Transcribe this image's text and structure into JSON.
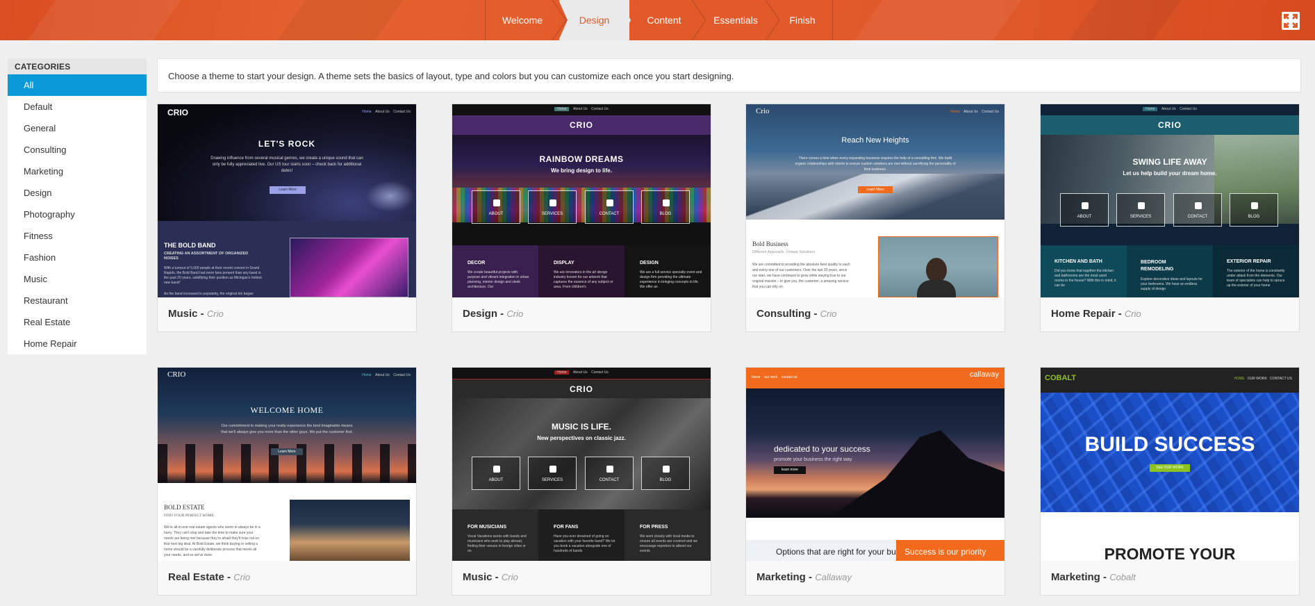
{
  "wizard": {
    "steps": [
      {
        "label": "Welcome",
        "active": false
      },
      {
        "label": "Design",
        "active": true
      },
      {
        "label": "Content",
        "active": false
      },
      {
        "label": "Essentials",
        "active": false
      },
      {
        "label": "Finish",
        "active": false
      }
    ],
    "fullscreen_icon": "fullscreen-exit-icon"
  },
  "sidebar": {
    "header": "CATEGORIES",
    "items": [
      "All",
      "Default",
      "General",
      "Consulting",
      "Marketing",
      "Design",
      "Photography",
      "Fitness",
      "Fashion",
      "Music",
      "Restaurant",
      "Real Estate",
      "Home Repair"
    ],
    "selected": "All"
  },
  "intro_text": "Choose a theme to start your design. A theme sets the basics of layout, type and colors but you can customize each once you start designing.",
  "themes": [
    {
      "name": "Music",
      "theme": "Crio",
      "preview": {
        "logo": "CRIO",
        "nav": [
          "Home",
          "About Us",
          "Contact Us"
        ],
        "hero_title": "LET'S ROCK",
        "hero_text": "Drawing influence from several musical genres, we create a unique sound that can only be fully appreciated live. Our US tour starts soon – check back for additional dates!",
        "hero_button": "Learn More",
        "section_title": "THE BOLD BAND",
        "section_subtitle": "CREATING AN ASSORTMENT OF ORGANIZED NOISES",
        "section_text": "With a turnout of 5,000 people at their recent concert in Grand Rapids, the Bold Band had more fans present than any band in the past 20 years, solidifying their position as Michigan's hottest new band!",
        "section_text2": "As the band increased in popularity, the original trio began"
      }
    },
    {
      "name": "Design",
      "theme": "Crio",
      "preview": {
        "logo": "CRIO",
        "nav": [
          "Home",
          "About Us",
          "Contact Us"
        ],
        "hero_title": "RAINBOW DREAMS",
        "hero_subtitle": "We bring design to life.",
        "boxes": [
          "ABOUT",
          "SERVICES",
          "CONTACT",
          "BLOG"
        ],
        "columns": [
          {
            "title": "DECOR",
            "text": "We create beautiful projects with purpose and vibrant integration in urban planning, interior design and sleek architecture. Our"
          },
          {
            "title": "DISPLAY",
            "text": "We are innovators in the art design industry known for our artwork that captures the essence of any subject or area. From children's"
          },
          {
            "title": "DESIGN",
            "text": "We are a full service specialty event and design firm providing the ultimate experience in bringing concepts to life. We offer an"
          }
        ]
      }
    },
    {
      "name": "Consulting",
      "theme": "Crio",
      "preview": {
        "logo": "Crio",
        "nav": [
          "Home",
          "About Us",
          "Contact Us"
        ],
        "hero_title": "Reach New Heights",
        "hero_text": "There comes a time when every expanding business requires the help of a consulting firm. We build organic relationships with clients to ensure custom solutions are met without sacrificing the personality of their business.",
        "hero_button": "Learn More",
        "section_title": "Bold Business",
        "section_subtitle": "Different Approach, Unique Solutions",
        "section_text": "We are committed to providing the absolute best quality to each and every one of our customers. Over the last 20 years, since our start, we have continued to grow while staying true to our original mission – to give you, the customer, a amazing service that you can rely on."
      }
    },
    {
      "name": "Home Repair",
      "theme": "Crio",
      "preview": {
        "logo": "CRIO",
        "nav": [
          "Home",
          "About Us",
          "Contact Us"
        ],
        "hero_title": "SWING LIFE AWAY",
        "hero_subtitle": "Let us help build your dream home.",
        "boxes": [
          "ABOUT",
          "SERVICES",
          "CONTACT",
          "BLOG"
        ],
        "columns": [
          {
            "title": "KITCHEN AND BATH",
            "text": "Did you know that together the kitchen and bathrooms are the most used rooms in the house? With this in mind, it can be"
          },
          {
            "title": "BEDROOM REMODELING",
            "text": "Explore decorative ideas and layouts for your bedrooms. We have an endless supply of design"
          },
          {
            "title": "EXTERIOR REPAIR",
            "text": "The exterior of the home is constantly under attack from the elements. Our team of specialists can help to spruce up the exterior of your home"
          }
        ]
      }
    },
    {
      "name": "Real Estate",
      "theme": "Crio",
      "preview": {
        "logo": "CRIO",
        "nav": [
          "Home",
          "About Us",
          "Contact Us"
        ],
        "hero_title": "WELCOME HOME",
        "hero_text": "Our commitment to making your realty experience the best imaginable means that we'll always give you more than the other guys. We put the customer first.",
        "hero_button": "Learn More",
        "section_title": "BOLD ESTATE",
        "section_subtitle": "FIND YOUR PERFECT HOME",
        "section_text": "We're all-in-one real estate agents who seem to always be in a hurry. They can't stop and take the time to make sure your needs are being met because they're afraid they'll miss out on that next big deal. At Bold Estate, we think buying or selling a home should be a carefully deliberate process that meets all your needs, and so we've done"
      }
    },
    {
      "name": "Music",
      "theme": "Crio",
      "preview": {
        "logo": "CRIO",
        "nav": [
          "Home",
          "About Us",
          "Contact Us"
        ],
        "hero_title": "MUSIC IS LIFE.",
        "hero_subtitle": "New perspectives on classic jazz.",
        "boxes": [
          "ABOUT",
          "SERVICES",
          "CONTACT",
          "BLOG"
        ],
        "columns": [
          {
            "title": "FOR MUSICIANS",
            "text": "Vocal Vacations works with bands and musicians who seek to play abroad, finding their venues in foreign cities or on"
          },
          {
            "title": "FOR FANS",
            "text": "Have you ever dreamed of going on vacation with your favorite band? We let you book a vacation alongside one of hundreds of bands"
          },
          {
            "title": "FOR PRESS",
            "text": "We work closely with local media to ensure all events are covered and we encourage reporters to attend our events"
          }
        ]
      }
    },
    {
      "name": "Marketing",
      "theme": "Callaway",
      "preview": {
        "logo": "callaway",
        "nav": [
          "home",
          "our work",
          "contact us"
        ],
        "hero_title": "dedicated to your success",
        "hero_subtitle": "promote your business the right way",
        "hero_button": "learn more",
        "band_left": "Options that are right for your business",
        "band_right": "Success is our priority"
      }
    },
    {
      "name": "Marketing",
      "theme": "Cobalt",
      "preview": {
        "logo": "COBALT",
        "nav": [
          "HOME",
          "OUR WORK",
          "CONTACT US"
        ],
        "hero_title": "BUILD SUCCESS",
        "hero_button": "SEE OUR WORK",
        "section_title": "PROMOTE YOUR"
      }
    }
  ],
  "colors": {
    "accent_orange": "#e05a2a",
    "selected_blue": "#0a9ad8",
    "callaway_orange": "#f26b1d",
    "cobalt_blue": "#1b4fc7",
    "cobalt_green": "#8dc21f"
  }
}
